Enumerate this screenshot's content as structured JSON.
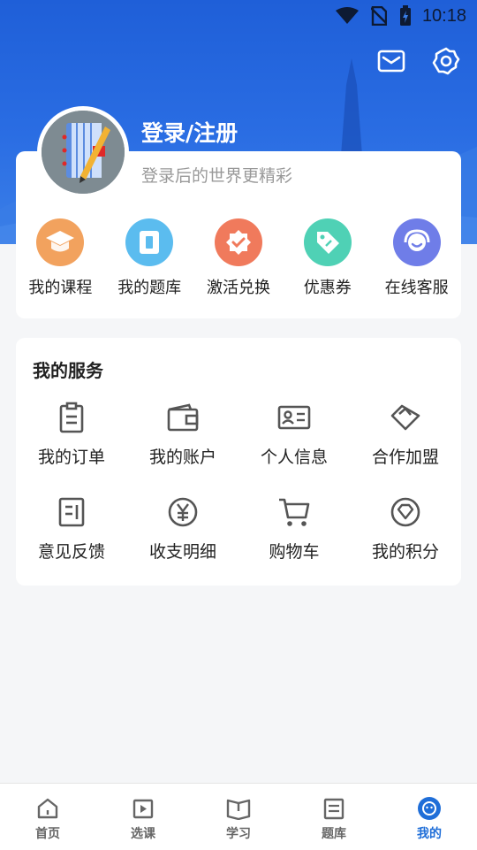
{
  "status_bar": {
    "time": "10:18"
  },
  "header": {
    "login_title": "登录/注册",
    "login_subtitle": "登录后的世界更精彩"
  },
  "quick_actions": [
    {
      "label": "我的课程",
      "icon": "graduation-cap-icon",
      "color": "#f2a25e"
    },
    {
      "label": "我的题库",
      "icon": "question-bank-icon",
      "color": "#5bbcef"
    },
    {
      "label": "激活兑换",
      "icon": "badge-check-icon",
      "color": "#f07a5c"
    },
    {
      "label": "优惠券",
      "icon": "coupon-tag-icon",
      "color": "#4fd1b5"
    },
    {
      "label": "在线客服",
      "icon": "headset-icon",
      "color": "#6f7de8"
    }
  ],
  "services": {
    "title": "我的服务",
    "items": [
      {
        "label": "我的订单",
        "icon": "clipboard-icon"
      },
      {
        "label": "我的账户",
        "icon": "wallet-icon"
      },
      {
        "label": "个人信息",
        "icon": "id-card-icon"
      },
      {
        "label": "合作加盟",
        "icon": "handshake-icon"
      },
      {
        "label": "意见反馈",
        "icon": "feedback-icon"
      },
      {
        "label": "收支明细",
        "icon": "yen-icon"
      },
      {
        "label": "购物车",
        "icon": "cart-icon"
      },
      {
        "label": "我的积分",
        "icon": "diamond-icon"
      }
    ]
  },
  "tabbar": {
    "items": [
      {
        "label": "首页",
        "icon": "home-icon"
      },
      {
        "label": "选课",
        "icon": "play-book-icon"
      },
      {
        "label": "学习",
        "icon": "open-book-icon"
      },
      {
        "label": "题库",
        "icon": "paper-icon"
      },
      {
        "label": "我的",
        "icon": "profile-face-icon"
      }
    ],
    "active_index": 4,
    "active_color": "#1f6ed8"
  }
}
